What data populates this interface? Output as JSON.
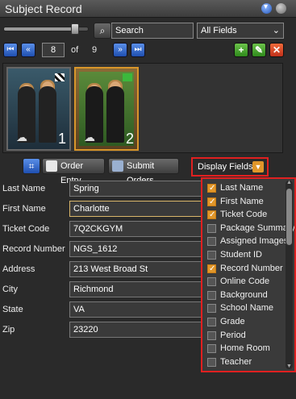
{
  "window": {
    "title": "Subject Record"
  },
  "toolbar": {
    "slider_level": 0.85,
    "search_value": "Search",
    "field_filter": "All Fields"
  },
  "pager": {
    "current_page": "8",
    "of_label": "of",
    "total": "9"
  },
  "gallery": {
    "thumbnails": [
      {
        "number": "1",
        "selected": false
      },
      {
        "number": "2",
        "selected": true
      }
    ]
  },
  "actions": {
    "order_entry": "Order Entry",
    "submit_orders": "Submit Orders",
    "display_fields": "Display Fields:"
  },
  "fields": [
    {
      "label": "Last Name",
      "value": "Spring"
    },
    {
      "label": "First Name",
      "value": "Charlotte"
    },
    {
      "label": "Ticket Code",
      "value": "7Q2CKGYM"
    },
    {
      "label": "Record Number",
      "value": "NGS_1612"
    },
    {
      "label": "Address",
      "value": "213 West Broad St"
    },
    {
      "label": "City",
      "value": "Richmond"
    },
    {
      "label": "State",
      "value": "VA"
    },
    {
      "label": "Zip",
      "value": "23220"
    }
  ],
  "display_fields_list": [
    {
      "label": "Last Name",
      "checked": true
    },
    {
      "label": "First Name",
      "checked": true
    },
    {
      "label": "Ticket Code",
      "checked": true
    },
    {
      "label": "Package Summary",
      "checked": false
    },
    {
      "label": "Assigned Images",
      "checked": false
    },
    {
      "label": "Student ID",
      "checked": false
    },
    {
      "label": "Record Number",
      "checked": true
    },
    {
      "label": "Online Code",
      "checked": false
    },
    {
      "label": "Background",
      "checked": false
    },
    {
      "label": "School Name",
      "checked": false
    },
    {
      "label": "Grade",
      "checked": false
    },
    {
      "label": "Period",
      "checked": false
    },
    {
      "label": "Home Room",
      "checked": false
    },
    {
      "label": "Teacher",
      "checked": false
    }
  ],
  "colors": {
    "accent": "#e0962a",
    "highlight": "#e02020",
    "nav": "#2f6fd8"
  }
}
